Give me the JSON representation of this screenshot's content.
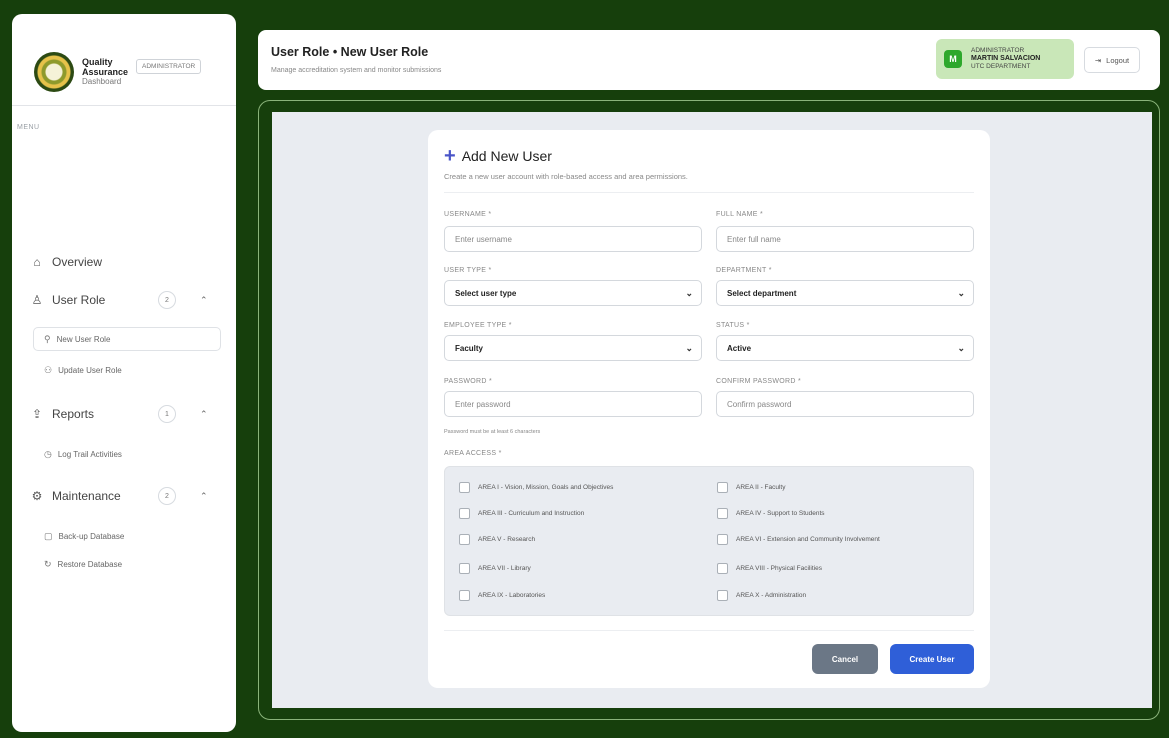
{
  "sidebar": {
    "brand_title_1": "Quality",
    "brand_title_2": "Assurance",
    "brand_sub": "Dashboard",
    "role_badge": "ADMINISTRATOR",
    "menu_label": "MENU",
    "overview": "Overview",
    "user_role": {
      "label": "User Role",
      "count": "2"
    },
    "new_user_role": "New User Role",
    "update_user_role": "Update User Role",
    "reports": {
      "label": "Reports",
      "count": "1"
    },
    "log_trail": "Log Trail Activities",
    "maintenance": {
      "label": "Maintenance",
      "count": "2"
    },
    "backup_db": "Back-up Database",
    "restore_db": "Restore Database"
  },
  "header": {
    "title": "User Role • New User Role",
    "subtitle": "Manage accreditation system and monitor submissions",
    "user_role": "ADMINISTRATOR",
    "user_name": "MARTIN SALVACION",
    "user_dept": "UTC DEPARTMENT",
    "avatar_letter": "M",
    "logout": "Logout"
  },
  "form": {
    "title": "Add New User",
    "subtitle": "Create a new user account with role-based access and area permissions.",
    "username_label": "USERNAME *",
    "username_placeholder": "Enter username",
    "fullname_label": "FULL NAME *",
    "fullname_placeholder": "Enter full name",
    "usertype_label": "USER TYPE *",
    "usertype_value": "Select user type",
    "department_label": "DEPARTMENT *",
    "department_value": "Select department",
    "employeetype_label": "EMPLOYEE TYPE *",
    "employeetype_value": "Faculty",
    "status_label": "STATUS *",
    "status_value": "Active",
    "password_label": "PASSWORD *",
    "password_placeholder": "Enter password",
    "confirm_label": "CONFIRM PASSWORD *",
    "confirm_placeholder": "Confirm password",
    "password_hint": "Password must be at least 6 characters",
    "area_access_label": "AREA ACCESS *",
    "areas": [
      "AREA I - Vision, Mission, Goals and Objectives",
      "AREA II - Faculty",
      "AREA III - Curriculum and Instruction",
      "AREA IV - Support to Students",
      "AREA V - Research",
      "AREA VI - Extension and Community Involvement",
      "AREA VII - Library",
      "AREA VIII - Physical Facilities",
      "AREA IX - Laboratories",
      "AREA X - Administration"
    ],
    "cancel": "Cancel",
    "create": "Create User"
  },
  "colors": {
    "background": "#163f0c",
    "accent_blue": "#2f5fd8",
    "cancel_gray": "#6b7786",
    "user_box": "#c9e7b8",
    "avatar_green": "#2ea82c"
  },
  "icons": {
    "overview": "home-icon",
    "user_role": "user-icon",
    "new_user_role": "user-plus-icon",
    "update_user_role": "users-icon",
    "reports": "upload-icon",
    "log_trail": "clock-icon",
    "maintenance": "gear-icon",
    "backup": "database-icon",
    "restore": "refresh-icon",
    "logout": "logout-icon"
  }
}
